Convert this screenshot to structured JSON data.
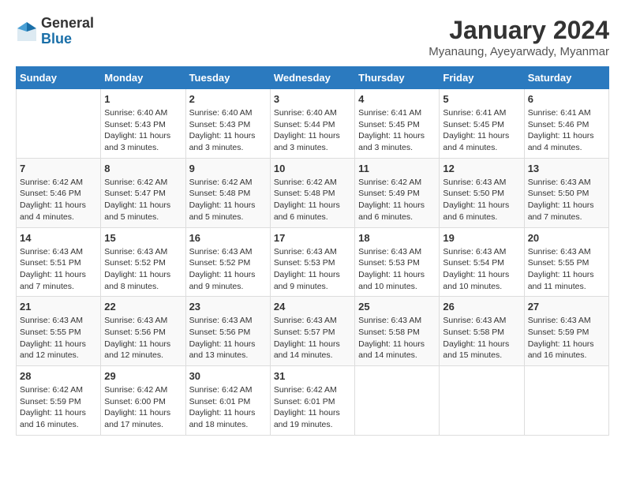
{
  "logo": {
    "general": "General",
    "blue": "Blue"
  },
  "header": {
    "month_year": "January 2024",
    "location": "Myanaung, Ayeyarwady, Myanmar"
  },
  "days_of_week": [
    "Sunday",
    "Monday",
    "Tuesday",
    "Wednesday",
    "Thursday",
    "Friday",
    "Saturday"
  ],
  "weeks": [
    [
      {
        "day": "",
        "sunrise": "",
        "sunset": "",
        "daylight": ""
      },
      {
        "day": "1",
        "sunrise": "Sunrise: 6:40 AM",
        "sunset": "Sunset: 5:43 PM",
        "daylight": "Daylight: 11 hours and 3 minutes."
      },
      {
        "day": "2",
        "sunrise": "Sunrise: 6:40 AM",
        "sunset": "Sunset: 5:43 PM",
        "daylight": "Daylight: 11 hours and 3 minutes."
      },
      {
        "day": "3",
        "sunrise": "Sunrise: 6:40 AM",
        "sunset": "Sunset: 5:44 PM",
        "daylight": "Daylight: 11 hours and 3 minutes."
      },
      {
        "day": "4",
        "sunrise": "Sunrise: 6:41 AM",
        "sunset": "Sunset: 5:45 PM",
        "daylight": "Daylight: 11 hours and 3 minutes."
      },
      {
        "day": "5",
        "sunrise": "Sunrise: 6:41 AM",
        "sunset": "Sunset: 5:45 PM",
        "daylight": "Daylight: 11 hours and 4 minutes."
      },
      {
        "day": "6",
        "sunrise": "Sunrise: 6:41 AM",
        "sunset": "Sunset: 5:46 PM",
        "daylight": "Daylight: 11 hours and 4 minutes."
      }
    ],
    [
      {
        "day": "7",
        "sunrise": "Sunrise: 6:42 AM",
        "sunset": "Sunset: 5:46 PM",
        "daylight": "Daylight: 11 hours and 4 minutes."
      },
      {
        "day": "8",
        "sunrise": "Sunrise: 6:42 AM",
        "sunset": "Sunset: 5:47 PM",
        "daylight": "Daylight: 11 hours and 5 minutes."
      },
      {
        "day": "9",
        "sunrise": "Sunrise: 6:42 AM",
        "sunset": "Sunset: 5:48 PM",
        "daylight": "Daylight: 11 hours and 5 minutes."
      },
      {
        "day": "10",
        "sunrise": "Sunrise: 6:42 AM",
        "sunset": "Sunset: 5:48 PM",
        "daylight": "Daylight: 11 hours and 6 minutes."
      },
      {
        "day": "11",
        "sunrise": "Sunrise: 6:42 AM",
        "sunset": "Sunset: 5:49 PM",
        "daylight": "Daylight: 11 hours and 6 minutes."
      },
      {
        "day": "12",
        "sunrise": "Sunrise: 6:43 AM",
        "sunset": "Sunset: 5:50 PM",
        "daylight": "Daylight: 11 hours and 6 minutes."
      },
      {
        "day": "13",
        "sunrise": "Sunrise: 6:43 AM",
        "sunset": "Sunset: 5:50 PM",
        "daylight": "Daylight: 11 hours and 7 minutes."
      }
    ],
    [
      {
        "day": "14",
        "sunrise": "Sunrise: 6:43 AM",
        "sunset": "Sunset: 5:51 PM",
        "daylight": "Daylight: 11 hours and 7 minutes."
      },
      {
        "day": "15",
        "sunrise": "Sunrise: 6:43 AM",
        "sunset": "Sunset: 5:52 PM",
        "daylight": "Daylight: 11 hours and 8 minutes."
      },
      {
        "day": "16",
        "sunrise": "Sunrise: 6:43 AM",
        "sunset": "Sunset: 5:52 PM",
        "daylight": "Daylight: 11 hours and 9 minutes."
      },
      {
        "day": "17",
        "sunrise": "Sunrise: 6:43 AM",
        "sunset": "Sunset: 5:53 PM",
        "daylight": "Daylight: 11 hours and 9 minutes."
      },
      {
        "day": "18",
        "sunrise": "Sunrise: 6:43 AM",
        "sunset": "Sunset: 5:53 PM",
        "daylight": "Daylight: 11 hours and 10 minutes."
      },
      {
        "day": "19",
        "sunrise": "Sunrise: 6:43 AM",
        "sunset": "Sunset: 5:54 PM",
        "daylight": "Daylight: 11 hours and 10 minutes."
      },
      {
        "day": "20",
        "sunrise": "Sunrise: 6:43 AM",
        "sunset": "Sunset: 5:55 PM",
        "daylight": "Daylight: 11 hours and 11 minutes."
      }
    ],
    [
      {
        "day": "21",
        "sunrise": "Sunrise: 6:43 AM",
        "sunset": "Sunset: 5:55 PM",
        "daylight": "Daylight: 11 hours and 12 minutes."
      },
      {
        "day": "22",
        "sunrise": "Sunrise: 6:43 AM",
        "sunset": "Sunset: 5:56 PM",
        "daylight": "Daylight: 11 hours and 12 minutes."
      },
      {
        "day": "23",
        "sunrise": "Sunrise: 6:43 AM",
        "sunset": "Sunset: 5:56 PM",
        "daylight": "Daylight: 11 hours and 13 minutes."
      },
      {
        "day": "24",
        "sunrise": "Sunrise: 6:43 AM",
        "sunset": "Sunset: 5:57 PM",
        "daylight": "Daylight: 11 hours and 14 minutes."
      },
      {
        "day": "25",
        "sunrise": "Sunrise: 6:43 AM",
        "sunset": "Sunset: 5:58 PM",
        "daylight": "Daylight: 11 hours and 14 minutes."
      },
      {
        "day": "26",
        "sunrise": "Sunrise: 6:43 AM",
        "sunset": "Sunset: 5:58 PM",
        "daylight": "Daylight: 11 hours and 15 minutes."
      },
      {
        "day": "27",
        "sunrise": "Sunrise: 6:43 AM",
        "sunset": "Sunset: 5:59 PM",
        "daylight": "Daylight: 11 hours and 16 minutes."
      }
    ],
    [
      {
        "day": "28",
        "sunrise": "Sunrise: 6:42 AM",
        "sunset": "Sunset: 5:59 PM",
        "daylight": "Daylight: 11 hours and 16 minutes."
      },
      {
        "day": "29",
        "sunrise": "Sunrise: 6:42 AM",
        "sunset": "Sunset: 6:00 PM",
        "daylight": "Daylight: 11 hours and 17 minutes."
      },
      {
        "day": "30",
        "sunrise": "Sunrise: 6:42 AM",
        "sunset": "Sunset: 6:01 PM",
        "daylight": "Daylight: 11 hours and 18 minutes."
      },
      {
        "day": "31",
        "sunrise": "Sunrise: 6:42 AM",
        "sunset": "Sunset: 6:01 PM",
        "daylight": "Daylight: 11 hours and 19 minutes."
      },
      {
        "day": "",
        "sunrise": "",
        "sunset": "",
        "daylight": ""
      },
      {
        "day": "",
        "sunrise": "",
        "sunset": "",
        "daylight": ""
      },
      {
        "day": "",
        "sunrise": "",
        "sunset": "",
        "daylight": ""
      }
    ]
  ]
}
